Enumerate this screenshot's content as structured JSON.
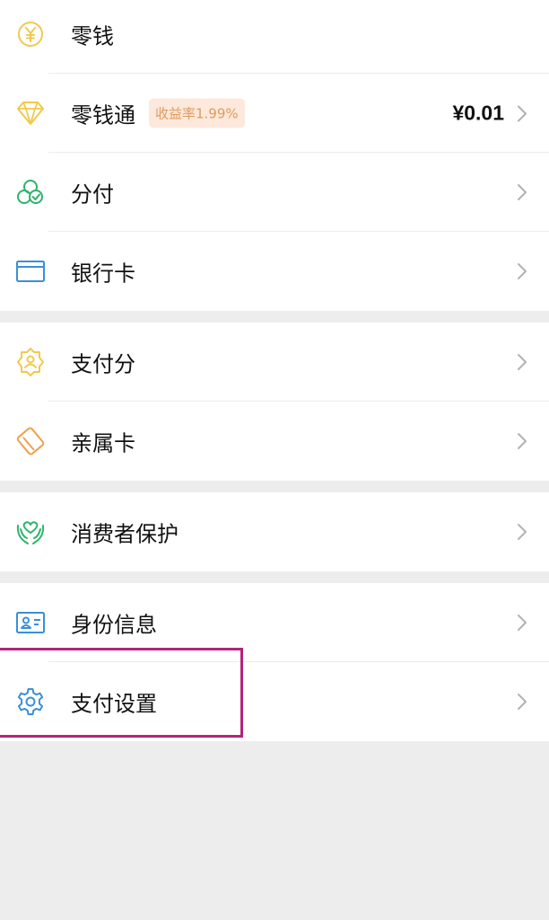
{
  "colors": {
    "background": "#ededed",
    "card": "#ffffff",
    "badge_bg": "#fde9dc",
    "badge_text": "#e09a5c",
    "highlight_border": "#b3237a"
  },
  "groups": [
    {
      "items": [
        {
          "label": "零钱",
          "icon": "yuan-coin-icon"
        },
        {
          "label": "零钱通",
          "icon": "diamond-icon",
          "badge": "收益率1.99%",
          "amount": "¥0.01"
        },
        {
          "label": "分付",
          "icon": "fenfu-icon"
        },
        {
          "label": "银行卡",
          "icon": "bank-card-icon"
        }
      ]
    },
    {
      "items": [
        {
          "label": "支付分",
          "icon": "pay-score-icon"
        },
        {
          "label": "亲属卡",
          "icon": "family-card-icon"
        }
      ]
    },
    {
      "items": [
        {
          "label": "消费者保护",
          "icon": "consumer-protection-icon"
        }
      ]
    },
    {
      "items": [
        {
          "label": "身份信息",
          "icon": "id-card-icon"
        },
        {
          "label": "支付设置",
          "icon": "gear-icon"
        }
      ]
    }
  ]
}
